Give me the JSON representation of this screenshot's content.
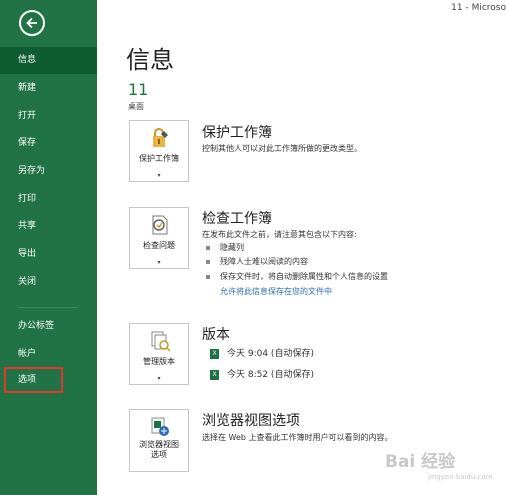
{
  "window": {
    "title_fragment": "11 - Microso"
  },
  "sidebar": {
    "items": [
      {
        "label": "信息"
      },
      {
        "label": "新建"
      },
      {
        "label": "打开"
      },
      {
        "label": "保存"
      },
      {
        "label": "另存为"
      },
      {
        "label": "打印"
      },
      {
        "label": "共享"
      },
      {
        "label": "导出"
      },
      {
        "label": "关闭"
      },
      {
        "label": "办公标签"
      },
      {
        "label": "帐户"
      },
      {
        "label": "选项"
      }
    ],
    "active": "信息",
    "highlighted": "选项",
    "colors": {
      "background": "#217346",
      "active": "#0f5c31",
      "highlight_border": "#e03a2f"
    }
  },
  "main": {
    "title": "信息",
    "file_name": "11",
    "file_location": "桌面",
    "sections": [
      {
        "button_label": "保护工作簿",
        "icon": "lock-icon",
        "title": "保护工作簿",
        "description": "控制其他人可以对此工作簿所做的更改类型。"
      },
      {
        "button_label": "检查问题",
        "icon": "inspect-icon",
        "title": "检查工作簿",
        "description": "在发布此文件之前，请注意其包含以下内容:",
        "bullets": [
          "隐藏列",
          "残障人士难以阅读的内容",
          "保存文件时，将自动删除属性和个人信息的设置"
        ],
        "link": "允许将此信息保存在您的文件中"
      },
      {
        "button_label": "管理版本",
        "icon": "versions-icon",
        "title": "版本",
        "versions": [
          "今天 9:04 (自动保存)",
          "今天 8:52 (自动保存)"
        ]
      },
      {
        "button_label_line1": "浏览器视图",
        "button_label_line2": "选项",
        "icon": "browser-view-icon",
        "title": "浏览器视图选项",
        "description": "选择在 Web 上查看此工作簿时用户可以看到的内容。"
      }
    ],
    "caret": "▾"
  },
  "watermark": {
    "text": "Bai 经验",
    "url": "jingyan.baidu.com"
  }
}
